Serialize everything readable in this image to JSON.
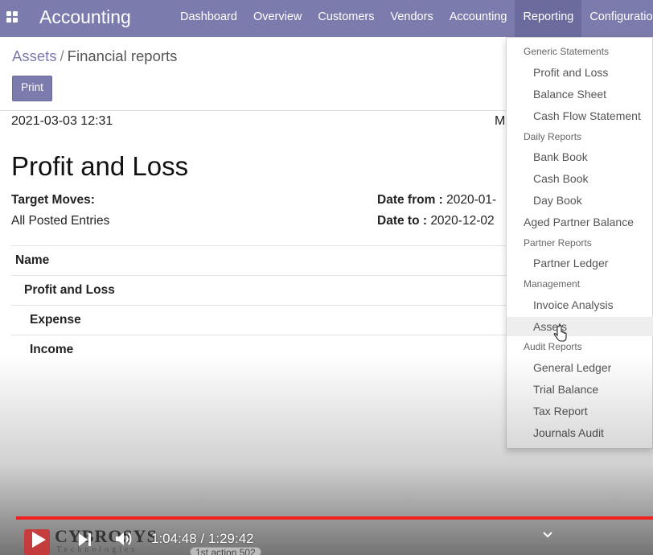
{
  "app": {
    "brand": "Accounting"
  },
  "nav": {
    "items": [
      {
        "label": "Dashboard"
      },
      {
        "label": "Overview"
      },
      {
        "label": "Customers"
      },
      {
        "label": "Vendors"
      },
      {
        "label": "Accounting"
      },
      {
        "label": "Reporting",
        "active": true
      },
      {
        "label": "Configuration"
      }
    ]
  },
  "breadcrumb": {
    "parent": "Assets",
    "separator": "/",
    "current": "Financial reports"
  },
  "toolbar": {
    "print_label": "Print"
  },
  "report": {
    "printed_at": "2021-03-03 12:31",
    "truncated_right": "M",
    "title": "Profit and Loss",
    "target_moves_label": "Target Moves:",
    "target_moves_value": "All Posted Entries",
    "date_from_label": "Date from :",
    "date_from_value": "2020-01-",
    "date_to_label": "Date to :",
    "date_to_value": "2020-12-02",
    "table": {
      "header": "Name",
      "rows": [
        "Profit and Loss",
        "Expense",
        "Income"
      ]
    }
  },
  "reporting_menu": {
    "generic_header": "Generic Statements",
    "generic_items": [
      "Profit and Loss",
      "Balance Sheet",
      "Cash Flow Statement"
    ],
    "daily_header": "Daily Reports",
    "daily_items": [
      "Bank Book",
      "Cash Book",
      "Day Book"
    ],
    "aged_partner": "Aged Partner Balance",
    "partner_header": "Partner Reports",
    "partner_items": [
      "Partner Ledger"
    ],
    "management_header": "Management",
    "management_items": [
      "Invoice Analysis",
      "Assets"
    ],
    "audit_header": "Audit Reports",
    "audit_items": [
      "General Ledger",
      "Trial Balance",
      "Tax Report",
      "Journals Audit"
    ],
    "hovered": "Assets"
  },
  "video": {
    "time": "1:04:48 / 1:29:42",
    "logo_text": "CYBROSYS",
    "logo_sub": "Technologies",
    "bottom_tag": "1st action 502",
    "accent_color": "#f02020"
  },
  "colors": {
    "brand": "#7c7bad",
    "nav_active": "#6c6b9e"
  }
}
